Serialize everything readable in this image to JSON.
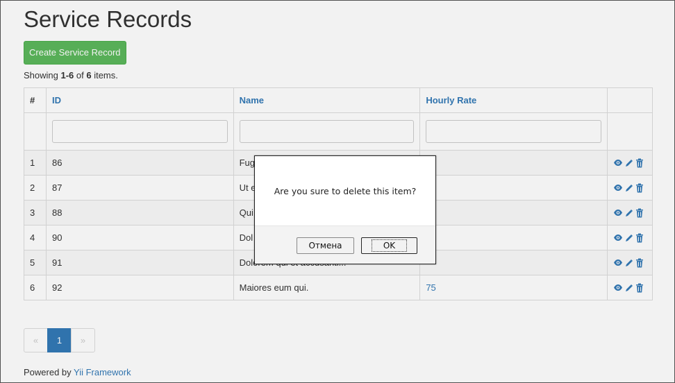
{
  "page": {
    "title": "Service Records",
    "create_button": "Create Service Record",
    "summary": {
      "prefix": "Showing ",
      "range": "1-6",
      "of": " of ",
      "total": "6",
      "suffix": " items."
    }
  },
  "table": {
    "columns": [
      "#",
      "ID",
      "Name",
      "Hourly Rate"
    ],
    "rows": [
      {
        "num": "1",
        "id": "86",
        "name": "Fug",
        "rate": ""
      },
      {
        "num": "2",
        "id": "87",
        "name": "Ut e",
        "rate": ""
      },
      {
        "num": "3",
        "id": "88",
        "name": "Qui",
        "rate": ""
      },
      {
        "num": "4",
        "id": "90",
        "name": "Dol",
        "rate": ""
      },
      {
        "num": "5",
        "id": "91",
        "name": "Dolorem qui et accusanti...",
        "rate": ""
      },
      {
        "num": "6",
        "id": "92",
        "name": "Maiores eum qui.",
        "rate": "75"
      }
    ],
    "action_icons": [
      "eye-icon",
      "pencil-icon",
      "trash-icon"
    ]
  },
  "pager": {
    "prev": "«",
    "pages": [
      "1"
    ],
    "next": "»"
  },
  "footer": {
    "text": "Powered by ",
    "link": "Yii Framework"
  },
  "dialog": {
    "message": "Are you sure to delete this item?",
    "cancel": "Отмена",
    "ok": "OK"
  },
  "colors": {
    "success": "#5cb85c",
    "link": "#337ab7"
  }
}
